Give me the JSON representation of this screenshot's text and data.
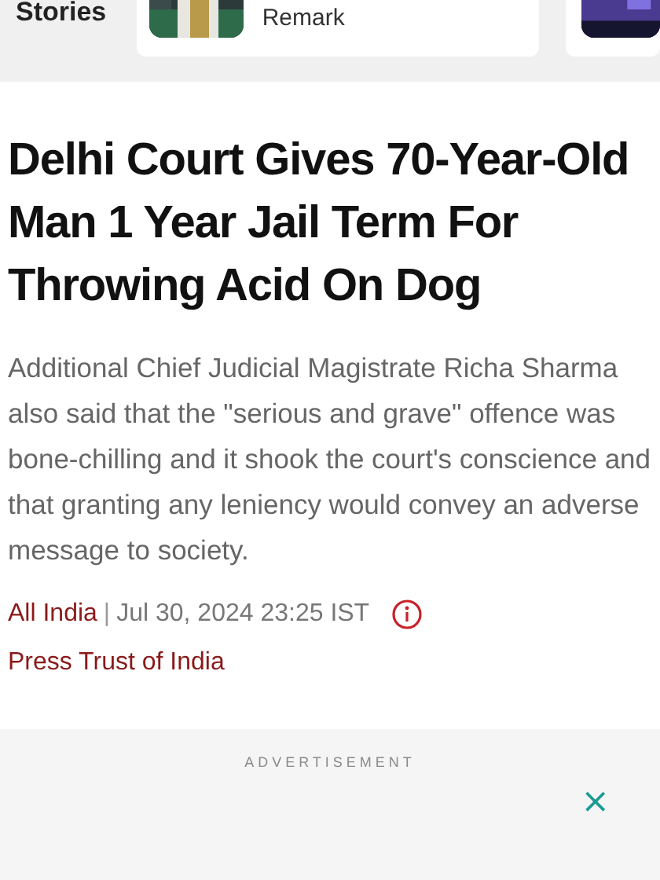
{
  "stories": {
    "heading": "Stories",
    "cards": [
      {
        "title": "Remark"
      },
      {
        "kind": "picture"
      }
    ]
  },
  "article": {
    "headline": "Delhi Court Gives 70-Year-Old Man 1 Year Jail Term For Throwing Acid On Dog",
    "summary": "Additional Chief Judicial Magistrate Richa Sharma also said that the \"serious and grave\" offence was bone-chilling and it shook the court's conscience and that granting any leniency would convey an adverse message to society.",
    "category": "All India",
    "separator": "|",
    "date": "Jul 30, 2024 23:25 IST",
    "source": "Press Trust of India"
  },
  "advertisement": {
    "label": "ADVERTISEMENT",
    "close": "×"
  }
}
